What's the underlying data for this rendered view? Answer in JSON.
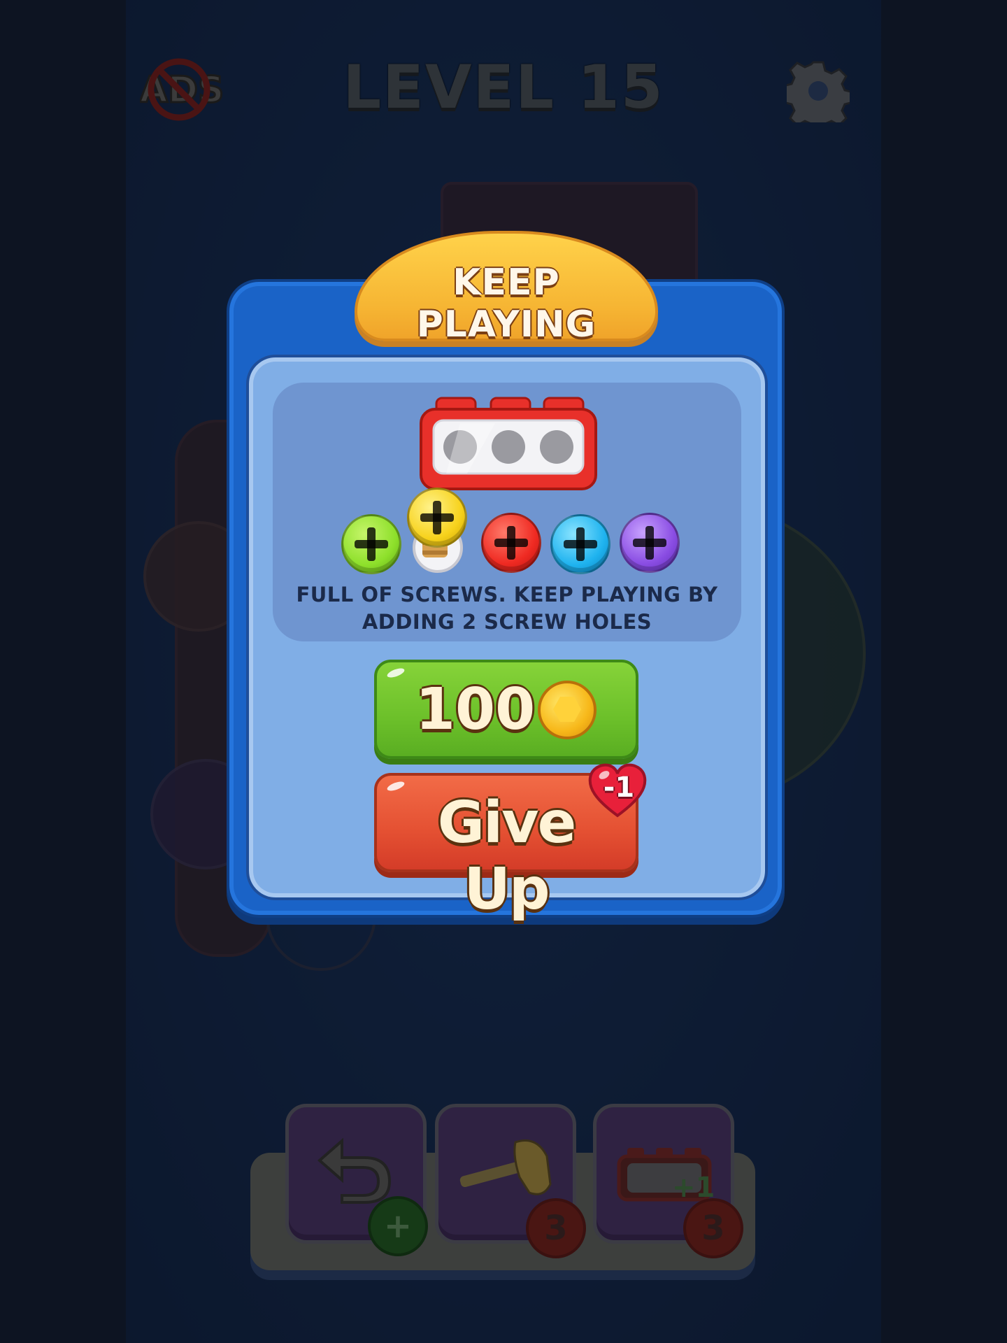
{
  "hud": {
    "level_title": "LEVEL 15",
    "remove_ads_icon": "no-ads-icon",
    "settings_icon": "gear-icon"
  },
  "dialog": {
    "title": "KEEP PLAYING",
    "message": "FULL OF SCREWS. KEEP PLAYING BY ADDING 2 SCREW HOLES",
    "screw_colors": [
      "#8ee02b",
      "#f7d21c",
      "#ef2a22",
      "#1fb3ef",
      "#8a4de3"
    ],
    "buy_button": {
      "price": "100",
      "currency_icon": "coin-icon"
    },
    "give_up_button": {
      "label": "Give Up",
      "penalty": "-1",
      "penalty_icon": "heart-icon"
    }
  },
  "boosters": [
    {
      "name": "undo",
      "icon": "undo-icon",
      "badge_icon": "plus-icon"
    },
    {
      "name": "hammer",
      "icon": "hammer-icon",
      "count": "3"
    },
    {
      "name": "extra-box",
      "icon": "extra-box-icon",
      "count": "3",
      "box_label": "+1"
    }
  ],
  "colors": {
    "modal_blue": "#1a63c7",
    "buy_green": "#6cc02a",
    "give_up_red": "#e45032",
    "title_orange": "#f6b533"
  }
}
